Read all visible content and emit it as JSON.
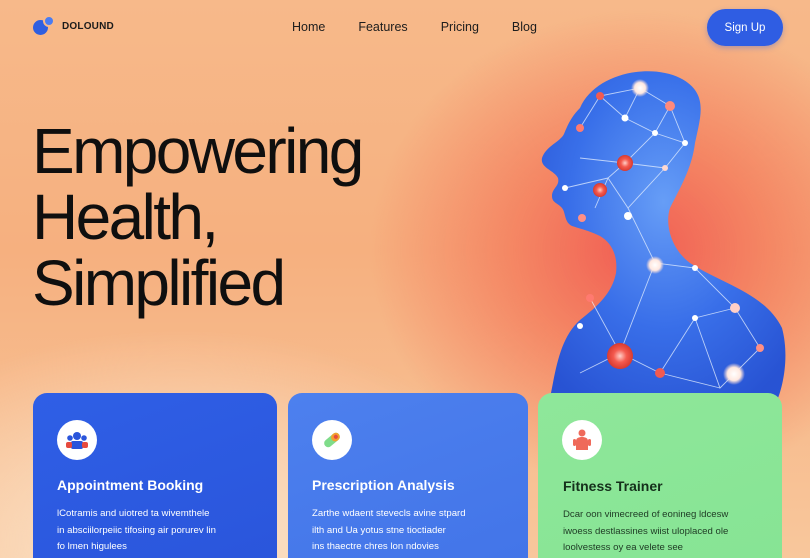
{
  "brand": {
    "name": "DOLOUND"
  },
  "nav": {
    "links": [
      "Home",
      "Features",
      "Pricing",
      "Blog"
    ],
    "signup_label": "Sign Up"
  },
  "hero": {
    "title": "Empowering\nHealth,\nSimplified"
  },
  "cards": [
    {
      "title": "Appointment Booking",
      "description": "lCotramis and uiotred ta wivemthele\nin absciilorpeiic tifosing air porurev lin\nfo lmen higulees",
      "icon": "users-group-icon"
    },
    {
      "title": "Prescription Analysis",
      "description": "Zarthe wdaent stevecls avine stpard\nilth and Ua yotus stne tioctiader\nins thaectre chres lon ndovies",
      "icon": "pill-capsule-icon"
    },
    {
      "title": "Fitness Trainer",
      "description": "Dcar oon vimecreed of eonineg ldcesw\niwoess destlassines wiist uloplaced ole\nloolvestess oy ea velete see",
      "icon": "trainer-person-icon"
    }
  ],
  "colors": {
    "accent": "#2f5de3",
    "card_blue": "#2f5fe6",
    "card_light_blue": "#4d80ee",
    "card_green": "#8fe79a",
    "background_peach": "#f7b98a",
    "glow_red": "#f05850"
  }
}
